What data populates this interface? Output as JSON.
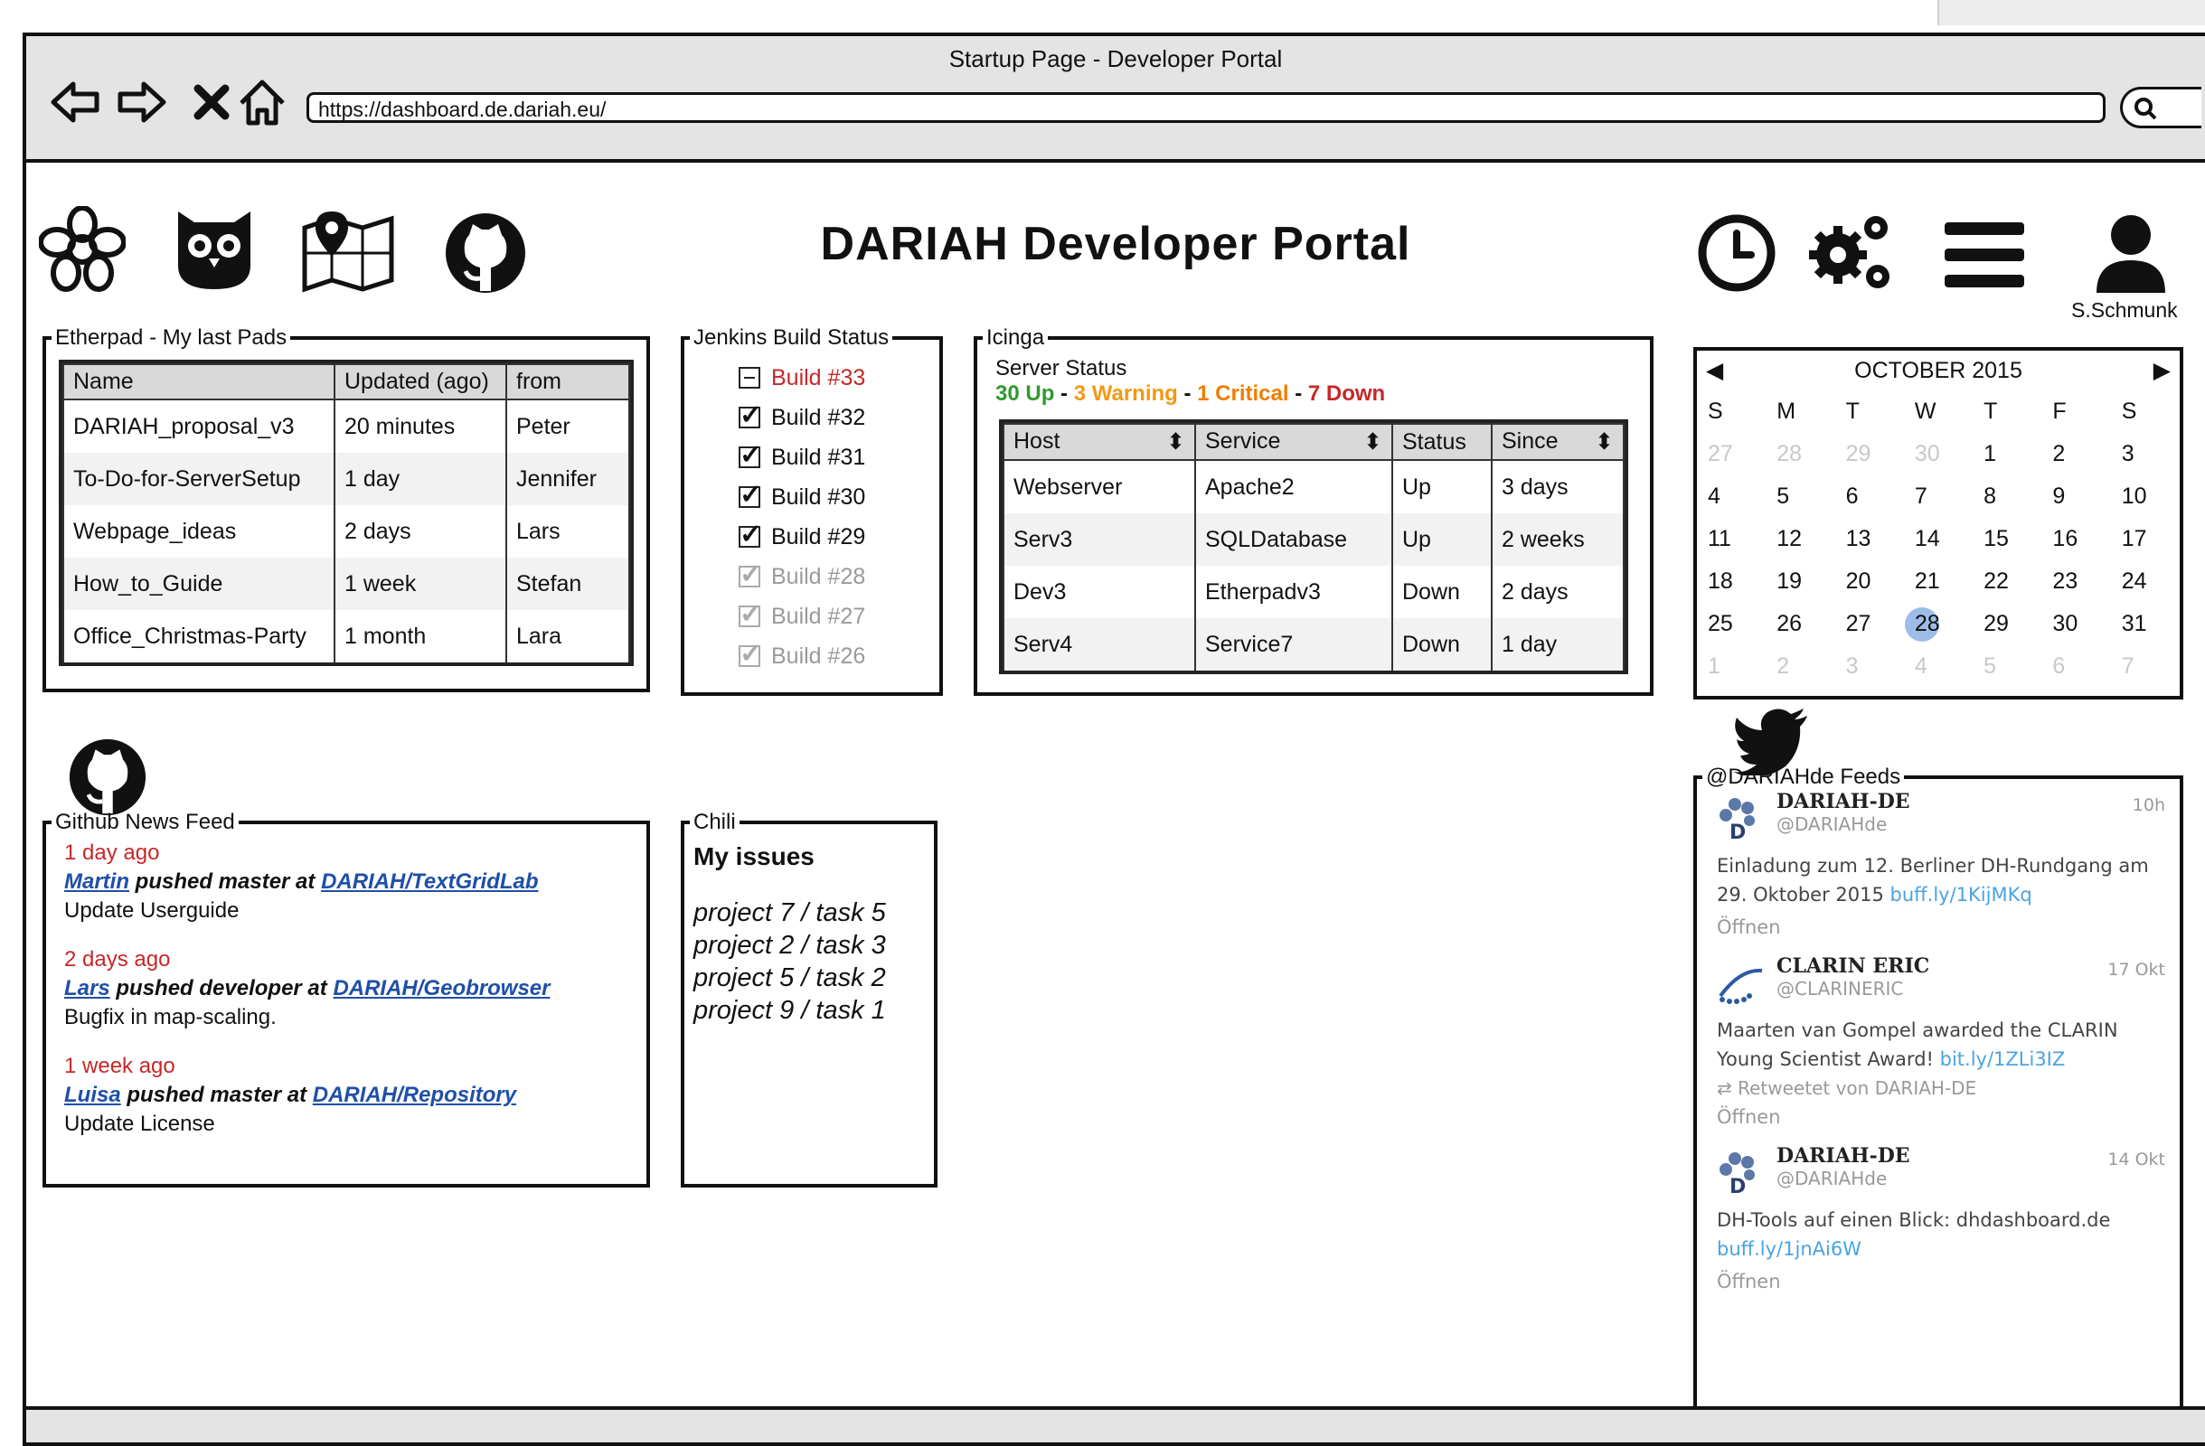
{
  "window": {
    "title": "Startup Page - Developer Portal",
    "url": "https://dashboard.de.dariah.eu/"
  },
  "header": {
    "title": "DARIAH Developer Portal",
    "user": "S.Schmunk"
  },
  "etherpad": {
    "legend": "Etherpad - My last Pads",
    "columns": [
      "Name",
      "Updated (ago)",
      "from"
    ],
    "rows": [
      [
        "DARIAH_proposal_v3",
        "20 minutes",
        "Peter"
      ],
      [
        "To-Do-for-ServerSetup",
        "1 day",
        "Jennifer"
      ],
      [
        "Webpage_ideas",
        "2 days",
        "Lars"
      ],
      [
        "How_to_Guide",
        "1 week",
        "Stefan"
      ],
      [
        "Office_Christmas-Party",
        "1 month",
        "Lara"
      ]
    ]
  },
  "jenkins": {
    "legend": "Jenkins Build Status",
    "builds": [
      {
        "label": "Build #33",
        "state": "minus",
        "style": "red"
      },
      {
        "label": "Build #32",
        "state": "checked",
        "style": "normal"
      },
      {
        "label": "Build #31",
        "state": "checked",
        "style": "normal"
      },
      {
        "label": "Build #30",
        "state": "checked",
        "style": "normal"
      },
      {
        "label": "Build #29",
        "state": "checked",
        "style": "normal"
      },
      {
        "label": "Build #28",
        "state": "checked",
        "style": "dim"
      },
      {
        "label": "Build #27",
        "state": "checked",
        "style": "dim"
      },
      {
        "label": "Build #26",
        "state": "checked",
        "style": "dim"
      }
    ]
  },
  "icinga": {
    "legend": "Icinga",
    "title": "Server Status",
    "summary": {
      "up": "30 Up",
      "warning": "3 Warning",
      "critical": "1 Critical",
      "down": "7 Down",
      "sep": " - "
    },
    "columns": [
      "Host",
      "Service",
      "Status",
      "Since"
    ],
    "rows": [
      [
        "Webserver",
        "Apache2",
        "Up",
        "3 days"
      ],
      [
        "Serv3",
        "SQLDatabase",
        "Up",
        "2 weeks"
      ],
      [
        "Dev3",
        "Etherpadv3",
        "Down",
        "2 days"
      ],
      [
        "Serv4",
        "Service7",
        "Down",
        "1 day"
      ]
    ]
  },
  "calendar": {
    "month": "OCTOBER 2015",
    "weekdays": [
      "S",
      "M",
      "T",
      "W",
      "T",
      "F",
      "S"
    ],
    "today": "28",
    "weeks": [
      [
        "27",
        "28",
        "29",
        "30",
        "1",
        "2",
        "3"
      ],
      [
        "4",
        "5",
        "6",
        "7",
        "8",
        "9",
        "10"
      ],
      [
        "11",
        "12",
        "13",
        "14",
        "15",
        "16",
        "17"
      ],
      [
        "18",
        "19",
        "20",
        "21",
        "22",
        "23",
        "24"
      ],
      [
        "25",
        "26",
        "27",
        "28",
        "29",
        "30",
        "31"
      ],
      [
        "1",
        "2",
        "3",
        "4",
        "5",
        "6",
        "7"
      ]
    ]
  },
  "github": {
    "legend": "Github News Feed",
    "entries": [
      {
        "time": "1 day ago",
        "user": "Martin",
        "action": " pushed master at ",
        "repo": "DARIAH/TextGridLab",
        "message": "Update Userguide"
      },
      {
        "time": "2 days ago",
        "user": "Lars",
        "action": " pushed developer at ",
        "repo": "DARIAH/Geobrowser",
        "message": "Bugfix in map-scaling."
      },
      {
        "time": "1 week ago",
        "user": "Luisa",
        "action": " pushed master at ",
        "repo": "DARIAH/Repository",
        "message": "Update License"
      }
    ]
  },
  "chili": {
    "legend": "Chili",
    "title": "My issues",
    "items": [
      "project 7 / task 5",
      "project 2 / task 3",
      "project 5 / task 2",
      "project 9 / task 1"
    ]
  },
  "twitter": {
    "legend": "@DARIAHde Feeds",
    "tweets": [
      {
        "name": "DARIAH-DE",
        "handle": "@DARIAHde",
        "time": "10h",
        "text_a": "Einladung zum 12. Berliner DH-Rundgang am 29. Oktober 2015 ",
        "link": "buff.ly/1KijMKq",
        "retweet": "",
        "open": "Öffnen",
        "avatar": "dariah"
      },
      {
        "name": "CLARIN ERIC",
        "handle": "@CLARINERIC",
        "time": "17 Okt",
        "text_a": "Maarten van Gompel awarded the CLARIN Young Scientist Award! ",
        "link": "bit.ly/1ZLi3IZ",
        "retweet": "Retweetet von DARIAH-DE",
        "open": "Öffnen",
        "avatar": "clarin"
      },
      {
        "name": "DARIAH-DE",
        "handle": "@DARIAHde",
        "time": "14 Okt",
        "text_a": "DH-Tools auf einen Blick: dhdashboard.de ",
        "link": "buff.ly/1jnAi6W",
        "retweet": "",
        "open": "Öffnen",
        "avatar": "dariah"
      }
    ]
  }
}
